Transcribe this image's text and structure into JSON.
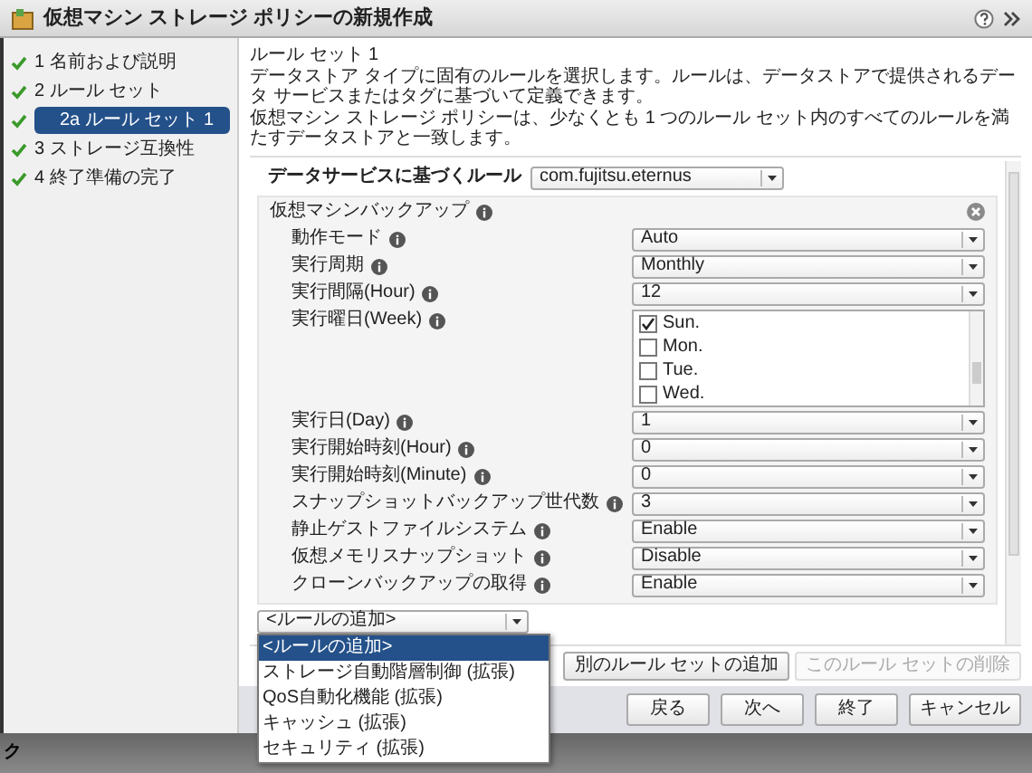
{
  "window": {
    "title": "仮想マシン ストレージ ポリシーの新規作成"
  },
  "sidebar": {
    "steps": [
      {
        "label": "1 名前および説明",
        "done": true,
        "selected": false
      },
      {
        "label": "2 ルール セット",
        "done": true,
        "selected": false,
        "children": [
          {
            "label": "2a ルール セット 1",
            "done": true,
            "selected": true
          }
        ]
      },
      {
        "label": "3 ストレージ互換性",
        "done": true,
        "selected": false
      },
      {
        "label": "4 終了準備の完了",
        "done": true,
        "selected": false
      }
    ]
  },
  "content": {
    "heading": "ルール セット 1",
    "description": [
      "データストア タイプに固有のルールを選択します。ルールは、データストアで提供されるデータ サービスまたはタグに基づいて定義できます。",
      "仮想マシン ストレージ ポリシーは、少なくとも 1 つのルール セット内のすべてのルールを満たすデータストアと一致します。"
    ],
    "data_service": {
      "label": "データサービスに基づくルール",
      "value": "com.fujitsu.eternus"
    },
    "rule_group": {
      "title": "仮想マシンバックアップ",
      "rules": [
        {
          "kind": "select",
          "label": "動作モード",
          "value": "Auto"
        },
        {
          "kind": "select",
          "label": "実行周期",
          "value": "Monthly"
        },
        {
          "kind": "select",
          "label": "実行間隔(Hour)",
          "value": "12"
        },
        {
          "kind": "checklist",
          "label": "実行曜日(Week)",
          "options": [
            {
              "label": "Sun.",
              "checked": true
            },
            {
              "label": "Mon.",
              "checked": false
            },
            {
              "label": "Tue.",
              "checked": false
            },
            {
              "label": "Wed.",
              "checked": false
            }
          ]
        },
        {
          "kind": "select",
          "label": "実行日(Day)",
          "value": "1"
        },
        {
          "kind": "select",
          "label": "実行開始時刻(Hour)",
          "value": "0"
        },
        {
          "kind": "select",
          "label": "実行開始時刻(Minute)",
          "value": "0"
        },
        {
          "kind": "select",
          "label": "スナップショットバックアップ世代数",
          "value": "3"
        },
        {
          "kind": "select",
          "label": "静止ゲストファイルシステム",
          "value": "Enable"
        },
        {
          "kind": "select",
          "label": "仮想メモリスナップショット",
          "value": "Disable"
        },
        {
          "kind": "select",
          "label": "クローンバックアップの取得",
          "value": "Enable"
        }
      ]
    },
    "add_rule": {
      "value": "<ルールの追加>",
      "menu": [
        {
          "label": "<ルールの追加>",
          "selected": true
        },
        {
          "label": "ストレージ自動階層制御 (拡張)",
          "selected": false
        },
        {
          "label": "QoS自動化機能 (拡張)",
          "selected": false
        },
        {
          "label": "キャッシュ (拡張)",
          "selected": false
        },
        {
          "label": "セキュリティ (拡張)",
          "selected": false
        }
      ]
    },
    "ruleset_buttons": [
      {
        "label": "別のルール セットの追加",
        "disabled": false
      },
      {
        "label": "このルール セットの削除",
        "disabled": true
      }
    ]
  },
  "footer_buttons": [
    "戻る",
    "次へ",
    "終了",
    "キャンセル"
  ],
  "background_text": "ク"
}
